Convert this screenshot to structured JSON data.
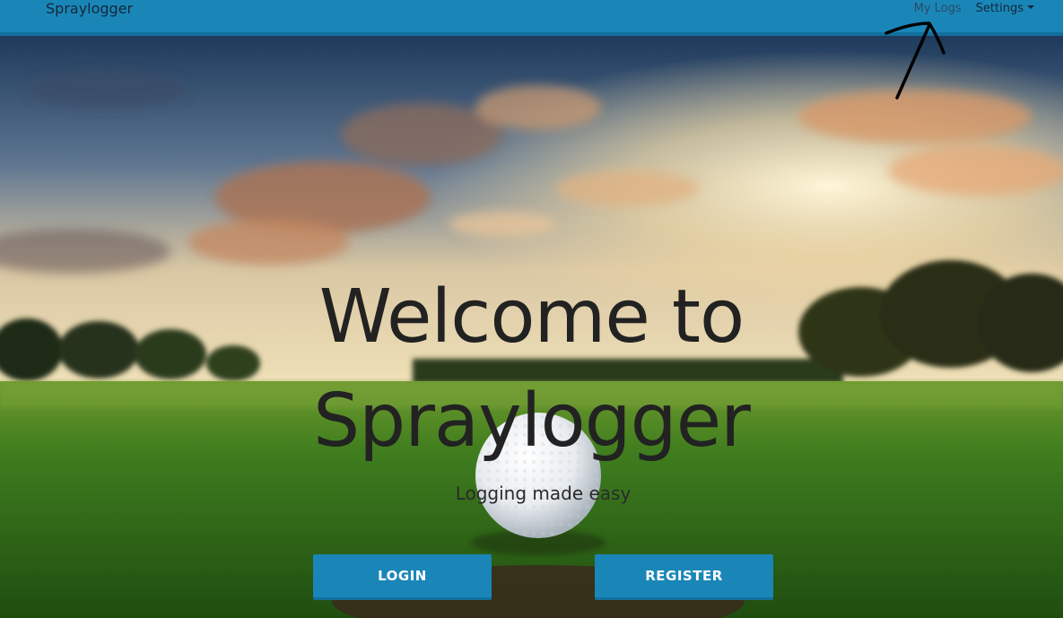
{
  "navbar": {
    "brand": "Spraylogger",
    "links": {
      "my_logs": "My Logs",
      "settings": "Settings"
    },
    "colors": {
      "background": "#1a86b8",
      "border": "#12709c"
    }
  },
  "hero": {
    "headline_line1": "Welcome to",
    "headline_line2": "Spraylogger",
    "subtitle": "Logging made easy",
    "buttons": {
      "login": "LOGIN",
      "register": "REGISTER"
    },
    "background_image": "golf-ball-on-green-at-sunset"
  },
  "annotation": {
    "icon": "hand-drawn-arrow-icon"
  }
}
